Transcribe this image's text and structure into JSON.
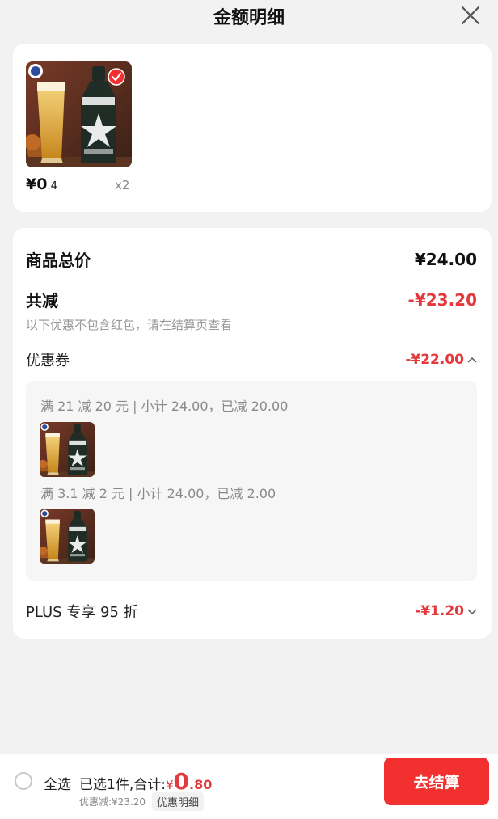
{
  "header": {
    "title": "金额明细"
  },
  "product": {
    "price_symbol_int": "¥0",
    "price_decimal": ".4",
    "quantity": "x2"
  },
  "summary": {
    "total_label": "商品总价",
    "total_value": "¥24.00",
    "reduce_label": "共减",
    "reduce_value": "-¥23.20",
    "note": "以下优惠不包含红包，请在结算页查看"
  },
  "coupon": {
    "label": "优惠券",
    "value": "-¥22.00",
    "items": [
      {
        "text": "满 21 减 20 元 | 小计 24.00，已减 20.00"
      },
      {
        "text": "满 3.1 减 2 元 | 小计 24.00，已减 2.00"
      }
    ]
  },
  "plus": {
    "label": "PLUS 专享 95 折",
    "value": "-¥1.20"
  },
  "bottom": {
    "select_all": "全选",
    "selected_text": "已选1件,合计:",
    "total_currency": "¥",
    "total_int": "0",
    "total_decimal": ".80",
    "discount_text": "优惠减:¥23.20",
    "detail_link": "优惠明细",
    "checkout": "去结算"
  },
  "colors": {
    "accent_red": "#e4393c",
    "checkout_red": "#f23030"
  }
}
